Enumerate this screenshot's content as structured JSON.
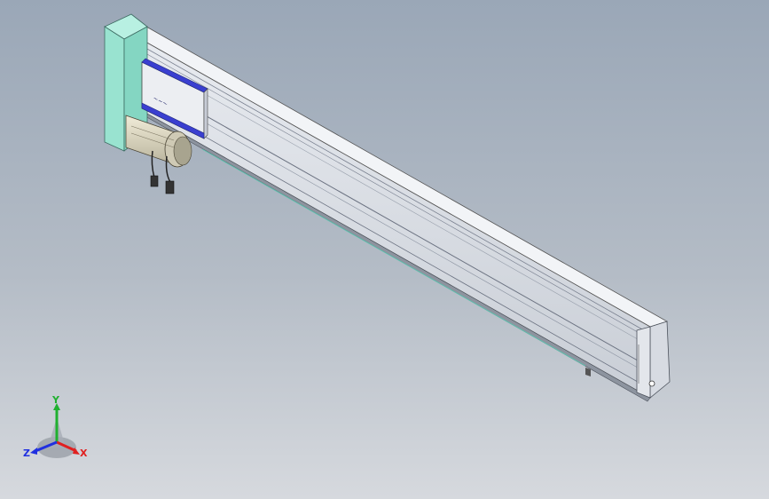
{
  "viewport": {
    "axes": {
      "x": "X",
      "y": "Y",
      "z": "Z"
    }
  },
  "colors": {
    "background_top": "#9aa7b7",
    "background_bottom": "#d6d9de",
    "rail_face": "#dde0e6",
    "rail_top": "#eef0f4",
    "motor_mount": "#99e3d0",
    "carriage_accent": "#3a3fd0",
    "axis_x": "#e02020",
    "axis_y": "#20b030",
    "axis_z": "#2030e0"
  }
}
